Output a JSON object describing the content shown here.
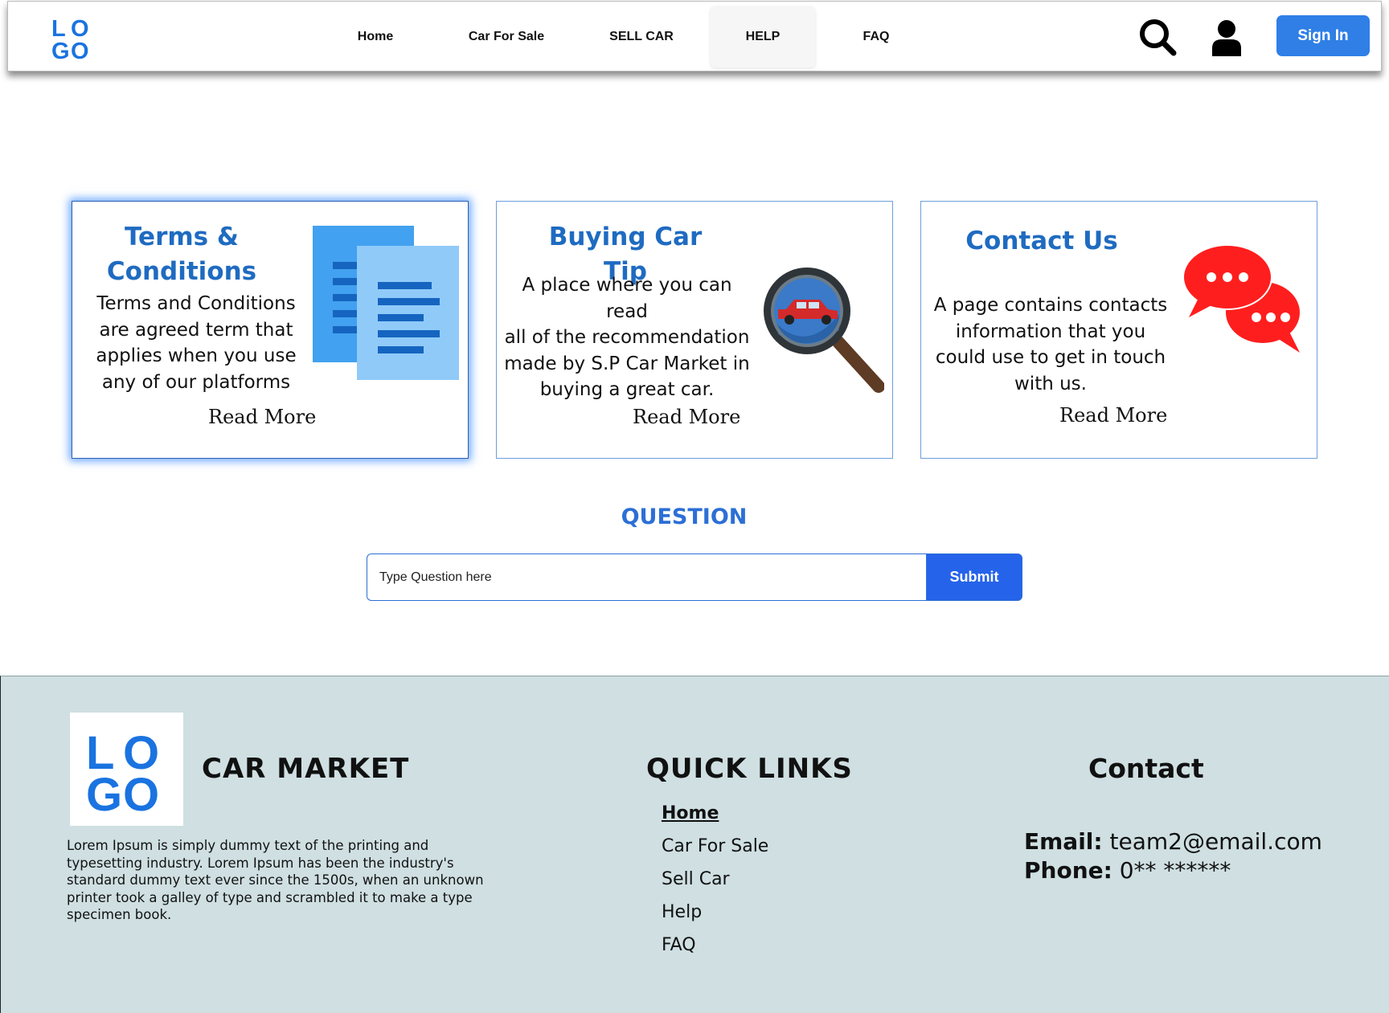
{
  "header": {
    "logo_text": [
      "L",
      "O",
      "G",
      "O"
    ],
    "nav": [
      {
        "label": "Home"
      },
      {
        "label": "Car For Sale"
      },
      {
        "label": "SELL CAR"
      },
      {
        "label": "HELP",
        "active": true
      },
      {
        "label": "FAQ"
      }
    ],
    "search_icon": "search-icon",
    "user_icon": "user-icon",
    "signin_label": "Sign In"
  },
  "cards": [
    {
      "title_line1": "Terms &",
      "title_line2": "Conditions",
      "desc": [
        "Terms and Conditions",
        "are agreed term that",
        "applies when you use",
        "any of our platforms"
      ],
      "read_more": "Read More",
      "icon": "documents-icon",
      "highlighted": true
    },
    {
      "title": "Buying Car Tip",
      "desc": [
        "A place where you can read",
        "all of the recommendation",
        "made by S.P Car Market in",
        "buying a  great car."
      ],
      "read_more": "Read More",
      "icon": "magnifier-car-icon"
    },
    {
      "title": "Contact Us",
      "desc": [
        "A page contains contacts",
        "information that you",
        "could use to get in touch",
        "with us."
      ],
      "read_more": "Read More",
      "icon": "chat-bubbles-icon"
    }
  ],
  "question": {
    "title": "QUESTION",
    "placeholder": "Type Question here",
    "submit_label": "Submit"
  },
  "footer": {
    "brand": "CAR MARKET",
    "description": "Lorem Ipsum is simply dummy text of the printing and typesetting industry. Lorem Ipsum has been the industry's standard dummy text ever since the 1500s, when an unknown printer took a galley of type and scrambled it to make a type specimen book.",
    "quick_links_title": "QUICK LINKS",
    "quick_links": [
      "Home",
      "Car For Sale",
      "Sell Car",
      "Help",
      "FAQ"
    ],
    "contact_title": "Contact",
    "email_label": "Email:",
    "email_value": "team2@email.com",
    "phone_label": "Phone:",
    "phone_value": "0** ******"
  },
  "colors": {
    "accent": "#2f7fe6",
    "submit": "#2563ea",
    "card_title": "#1f6bc1",
    "logo": "#1a73e0",
    "footer_bg": "#cfdfe2"
  }
}
